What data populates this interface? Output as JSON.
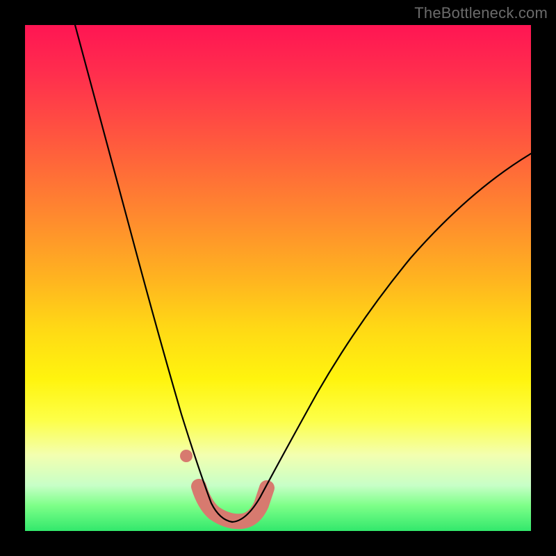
{
  "watermark": "TheBottleneck.com",
  "colors": {
    "frame": "#000000",
    "curve": "#000000",
    "highlight": "#d77a6f"
  },
  "chart_data": {
    "type": "line",
    "title": "",
    "xlabel": "",
    "ylabel": "",
    "xlim": [
      0,
      100
    ],
    "ylim": [
      0,
      100
    ],
    "grid": false,
    "legend": false,
    "series": [
      {
        "name": "left-branch",
        "x": [
          10,
          14,
          18,
          22,
          26,
          30,
          34,
          36.5
        ],
        "y": [
          100,
          82,
          65,
          49,
          34,
          21,
          10,
          4
        ]
      },
      {
        "name": "right-branch",
        "x": [
          44,
          48,
          55,
          62,
          70,
          80,
          90,
          100
        ],
        "y": [
          4,
          10,
          22,
          34,
          46,
          58,
          68,
          75
        ]
      },
      {
        "name": "valley-floor",
        "x": [
          36.5,
          38,
          40,
          42,
          44
        ],
        "y": [
          4,
          2.5,
          2,
          2.5,
          4
        ]
      }
    ],
    "highlight": {
      "name": "salmon-highlight",
      "x": [
        34,
        36.5,
        38,
        40,
        42,
        44,
        46
      ],
      "y": [
        8,
        4,
        2.5,
        2,
        2.5,
        4,
        7
      ]
    },
    "highlight_dot": {
      "x": 32.5,
      "y": 14
    }
  }
}
